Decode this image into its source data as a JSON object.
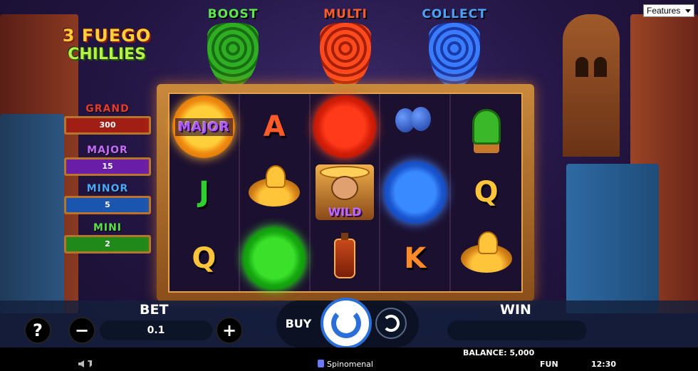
{
  "logo": {
    "line1": "3 FUEGO",
    "line2": "CHILLIES"
  },
  "jackpots": [
    {
      "name": "GRAND",
      "value": "300"
    },
    {
      "name": "MAJOR",
      "value": "15"
    },
    {
      "name": "MINOR",
      "value": "5"
    },
    {
      "name": "MINI",
      "value": "2"
    }
  ],
  "features_bar": [
    {
      "label": "BOOST",
      "color": "#5ae84a"
    },
    {
      "label": "MULTI",
      "color": "#ff5a2a"
    },
    {
      "label": "COLLECT",
      "color": "#4aa2ff"
    }
  ],
  "reels": {
    "coin_major_text": "MAJOR",
    "wild_text": "WILD",
    "letters": {
      "A": "A",
      "J": "J",
      "Q": "Q",
      "K": "K"
    },
    "grid": [
      [
        "coin-gold-major",
        "letter-J",
        "letter-Q"
      ],
      [
        "letter-A",
        "sombrero",
        "coin-green"
      ],
      [
        "coin-red",
        "wild",
        "hot-sauce-bottle"
      ],
      [
        "maracas",
        "coin-blue",
        "letter-K"
      ],
      [
        "cactus",
        "letter-Q",
        "sombrero"
      ]
    ]
  },
  "controls": {
    "help_label": "?",
    "minus_label": "−",
    "plus_label": "+",
    "bet_title": "BET",
    "bet_value": "0.1",
    "buy_label": "BUY",
    "win_title": "WIN",
    "win_value": ""
  },
  "status": {
    "balance": "BALANCE: 5,000",
    "brand": "Spinomenal",
    "mode": "FUN",
    "clock": "12:30"
  },
  "features_select": {
    "selected": "Features"
  }
}
